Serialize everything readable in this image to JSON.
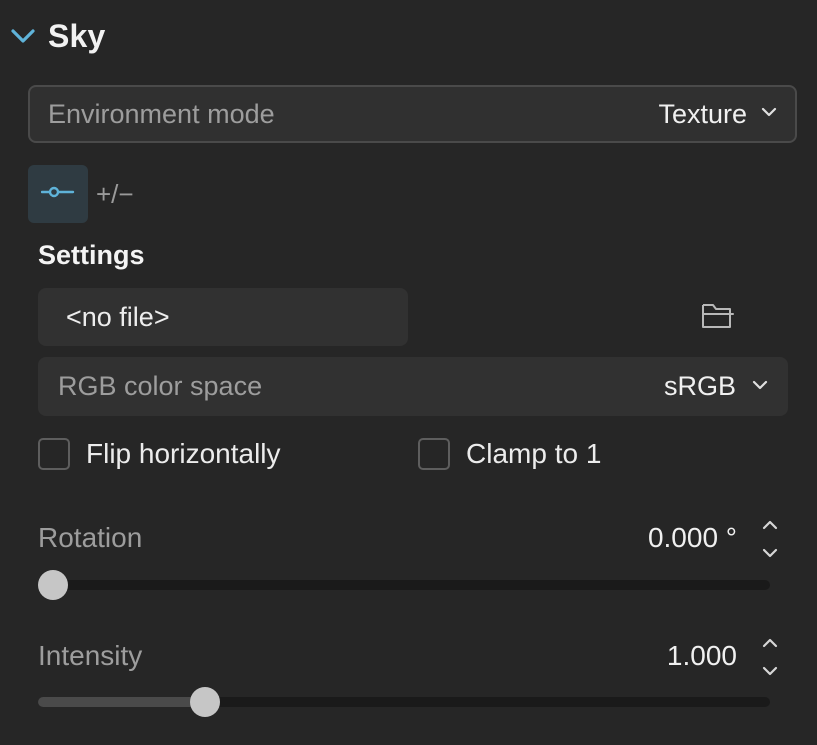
{
  "section": {
    "title": "Sky"
  },
  "environment_mode": {
    "label": "Environment mode",
    "value": "Texture"
  },
  "mode_tabs": [
    {
      "icon": "link-dot-icon",
      "active": true
    },
    {
      "label": "+/−",
      "active": false
    }
  ],
  "settings": {
    "heading": "Settings",
    "file": {
      "value": "<no file>"
    },
    "color_space": {
      "label": "RGB color space",
      "value": "sRGB"
    },
    "flip_horizontally": {
      "label": "Flip horizontally",
      "checked": false
    },
    "clamp_to_1": {
      "label": "Clamp to 1",
      "checked": false
    },
    "rotation": {
      "label": "Rotation",
      "value": "0.000 °",
      "fraction": 0.0
    },
    "intensity": {
      "label": "Intensity",
      "value": "1.000",
      "fraction": 0.217
    }
  },
  "colors": {
    "background": "#262626",
    "accent": "#5fb3d9",
    "thumb": "#c6c6c6",
    "track": "#1a1a1a"
  }
}
